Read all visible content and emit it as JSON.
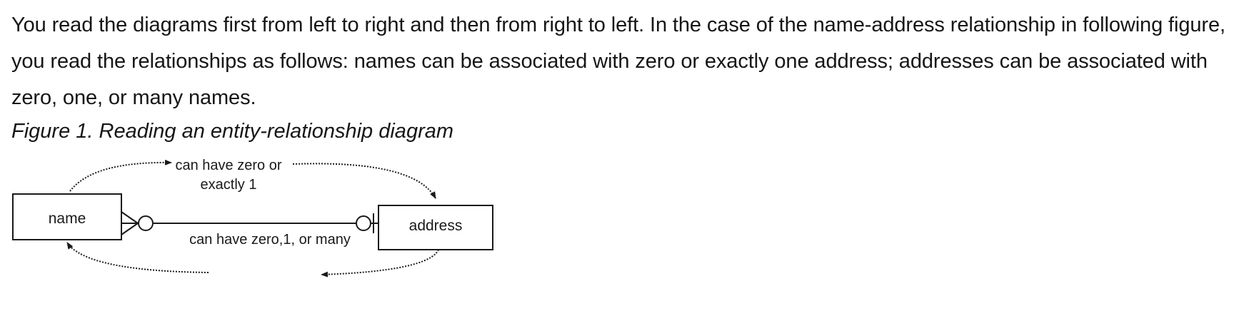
{
  "document": {
    "paragraph": "You read the diagrams first from left to right and then from right to left. In the case of the name-address relationship in following figure, you read the relationships as follows: names can be associated with zero or exactly one address; addresses can be associated with zero, one, or many names.",
    "figure_caption": "Figure 1. Reading an entity-relationship diagram"
  },
  "diagram": {
    "entities": {
      "left": "name",
      "right": "address"
    },
    "relationships": {
      "top_line1": "can have zero or",
      "top_line2": "exactly 1",
      "bottom": "can have zero,1, or many"
    }
  }
}
